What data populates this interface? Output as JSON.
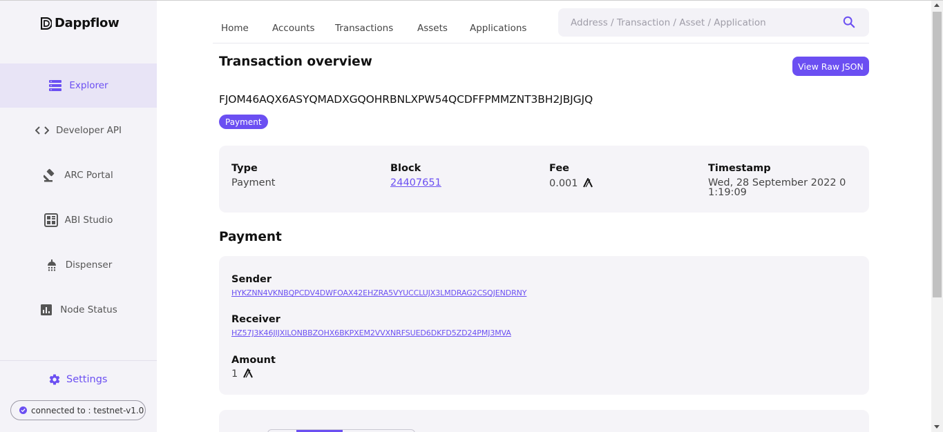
{
  "app": {
    "name": "Dappflow"
  },
  "sidebar": {
    "items": [
      {
        "label": "Explorer",
        "icon": "list-icon",
        "active": true
      },
      {
        "label": "Developer API",
        "icon": "code-icon"
      },
      {
        "label": "ARC Portal",
        "icon": "gavel-icon"
      },
      {
        "label": "ABI Studio",
        "icon": "grid-icon"
      },
      {
        "label": "Dispenser",
        "icon": "shower-icon"
      },
      {
        "label": "Node Status",
        "icon": "bar-chart-icon"
      }
    ],
    "settings_label": "Settings",
    "connection": "connected to : testnet-v1.0"
  },
  "topnav": {
    "items": [
      "Home",
      "Accounts",
      "Transactions",
      "Assets",
      "Applications"
    ],
    "search_placeholder": "Address / Transaction / Asset / Application"
  },
  "transaction": {
    "title": "Transaction overview",
    "raw_button": "View Raw JSON",
    "id": "FJOM46AQX6ASYQMADXGQOHRBNLXPW54QCDFFPMMZNT3BH2JBJGJQ",
    "badge": "Payment",
    "summary": {
      "type_label": "Type",
      "type_value": "Payment",
      "block_label": "Block",
      "block_value": "24407651",
      "fee_label": "Fee",
      "fee_value": "0.001",
      "timestamp_label": "Timestamp",
      "timestamp_value": "Wed, 28 September 2022 01:19:09"
    }
  },
  "payment": {
    "title": "Payment",
    "sender_label": "Sender",
    "sender": "HYKZNN4VKNBQPCDV4DWFOAX42EHZRA5VYUCCLUJX3LMDRAG2CSQJENDRNY",
    "receiver_label": "Receiver",
    "receiver": "HZ57J3K46JIJXILONBBZOHX6BKPXEM2VVXNRFSUED6DKFD5ZD24PMJ3MVA",
    "amount_label": "Amount",
    "amount": "1"
  },
  "colors": {
    "accent": "#6b4ff2",
    "sidebar_bg": "#f4f3f8",
    "card_bg": "#f5f4f8"
  }
}
